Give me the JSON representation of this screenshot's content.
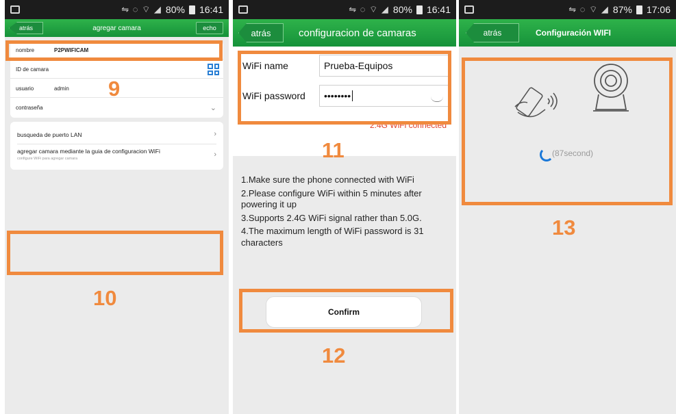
{
  "screen1": {
    "status": {
      "battery": "80%",
      "time": "16:41"
    },
    "back_label": "atrás",
    "title": "agregar camara",
    "done_label": "echo",
    "fields": [
      {
        "label": "nombre",
        "value": "P2PWIFICAM"
      },
      {
        "label": "ID de camara",
        "value": ""
      },
      {
        "label": "usuario",
        "value": "admin"
      },
      {
        "label": "contraseña",
        "value": ""
      }
    ],
    "nav_items": [
      {
        "label": "busqueda de puerto LAN",
        "sub": ""
      },
      {
        "label": "agregar camara mediante la guia de configuracion WiFi",
        "sub": "configure WiFi para agregar camara"
      }
    ]
  },
  "screen2": {
    "status": {
      "battery": "80%",
      "time": "16:41"
    },
    "back_label": "atrás",
    "title": "configuracion de camaras",
    "wifi_name_label": "WiFi name",
    "wifi_name_value": "Prueba-Equipos",
    "wifi_password_label": "WiFi password",
    "wifi_password_value": "••••••••",
    "wifi_status": "2.4G WiFi connected",
    "instructions": [
      "1.Make sure the phone connected with WiFi",
      "2.Please configure WiFi within 5 minutes after powering it up",
      "3.Supports 2.4G WiFi signal rather than 5.0G.",
      "4.The maximum length of WiFi password is 31 characters"
    ],
    "confirm_label": "Confirm"
  },
  "screen3": {
    "status": {
      "battery": "87%",
      "time": "17:06"
    },
    "back_label": "atrás",
    "title": "Configuración WIFI",
    "timer": "(87second)"
  },
  "annotations": [
    "9",
    "10",
    "11",
    "12",
    "13"
  ],
  "colors": {
    "appbar": "#1f9e40",
    "annotation": "#f08a3e",
    "spinner": "#1a78d8"
  }
}
